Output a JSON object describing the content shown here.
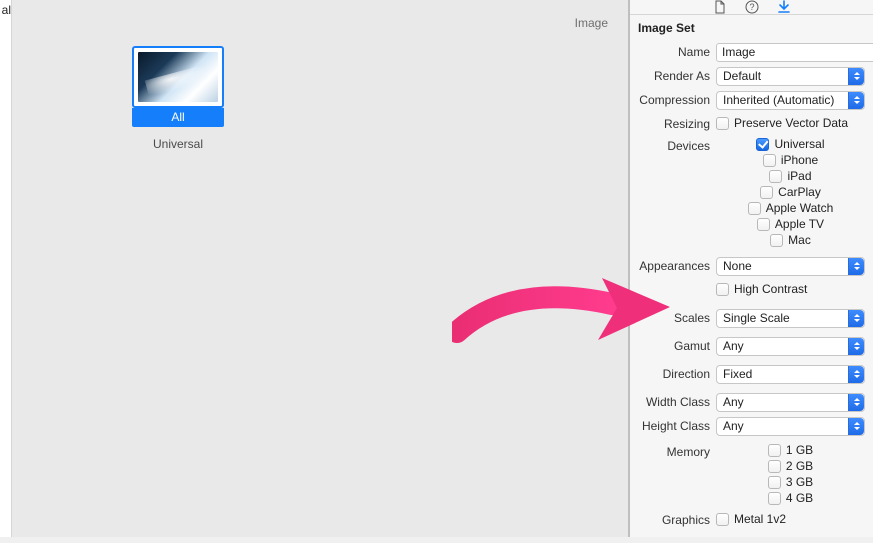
{
  "leftpane": {
    "fragment": "al"
  },
  "center": {
    "header": "Image",
    "slot_label": "All",
    "set_label": "Universal"
  },
  "inspector": {
    "section": "Image Set",
    "name": {
      "label": "Name",
      "value": "Image"
    },
    "render_as": {
      "label": "Render As",
      "value": "Default"
    },
    "compression": {
      "label": "Compression",
      "value": "Inherited (Automatic)"
    },
    "resizing": {
      "label": "Resizing",
      "option": "Preserve Vector Data",
      "checked": false
    },
    "devices": {
      "label": "Devices",
      "options": [
        {
          "label": "Universal",
          "checked": true
        },
        {
          "label": "iPhone",
          "checked": false
        },
        {
          "label": "iPad",
          "checked": false
        },
        {
          "label": "CarPlay",
          "checked": false
        },
        {
          "label": "Apple Watch",
          "checked": false
        },
        {
          "label": "Apple TV",
          "checked": false
        },
        {
          "label": "Mac",
          "checked": false
        }
      ]
    },
    "appearances": {
      "label": "Appearances",
      "value": "None",
      "hc_label": "High Contrast",
      "hc_checked": false
    },
    "scales": {
      "label": "Scales",
      "value": "Single Scale"
    },
    "gamut": {
      "label": "Gamut",
      "value": "Any"
    },
    "direction": {
      "label": "Direction",
      "value": "Fixed"
    },
    "width_class": {
      "label": "Width Class",
      "value": "Any"
    },
    "height_class": {
      "label": "Height Class",
      "value": "Any"
    },
    "memory": {
      "label": "Memory",
      "options": [
        {
          "label": "1 GB",
          "checked": false
        },
        {
          "label": "2 GB",
          "checked": false
        },
        {
          "label": "3 GB",
          "checked": false
        },
        {
          "label": "4 GB",
          "checked": false
        }
      ]
    },
    "graphics": {
      "label": "Graphics",
      "option": "Metal 1v2",
      "checked": false
    }
  }
}
